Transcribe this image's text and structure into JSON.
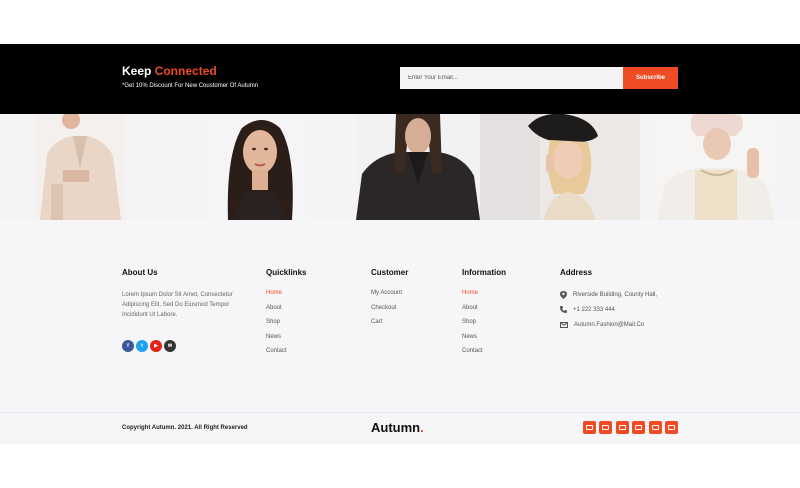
{
  "newsletter": {
    "title_part1": "Keep ",
    "title_part2": "Connected",
    "subtitle": "*Get 10% Discount For New Coustomer Of Autumn",
    "email_placeholder": "Enter Your Email...",
    "subscribe_label": "Subscribe"
  },
  "colors": {
    "accent": "#ef4b24",
    "band": "#000000",
    "footer_bg": "#f6f6f8"
  },
  "footer": {
    "about": {
      "heading": "About Us",
      "text": "Lorem Ipsum Dolor Sit Amet, Consectetur Adipiscing Elit, Sed Do Eiusmod Tempor Incididunt Ut Labore.",
      "socials": [
        "facebook-icon",
        "twitter-icon",
        "youtube-icon",
        "email-icon"
      ]
    },
    "quicklinks": {
      "heading": "Quicklinks",
      "items": [
        "Home",
        "About",
        "Shop",
        "News",
        "Contact"
      ]
    },
    "customer": {
      "heading": "Customer",
      "items": [
        "My Account",
        "Checkout",
        "Cart"
      ]
    },
    "information": {
      "heading": "Information",
      "items": [
        "Home",
        "About",
        "Shop",
        "News",
        "Contact"
      ]
    },
    "address": {
      "heading": "Address",
      "location": "Riverside Building, County Hall,",
      "phone": "+1 222 333 444",
      "email": "Autumn.Fashion@Mail.Co"
    }
  },
  "bottom": {
    "copyright": "Copyright Autumn. 2021. All Right Reserved",
    "logo_text": "Autumn",
    "logo_dot": ".",
    "payment_icons": [
      "card-icon",
      "card-icon",
      "card-icon",
      "card-icon",
      "card-icon",
      "card-icon"
    ]
  }
}
